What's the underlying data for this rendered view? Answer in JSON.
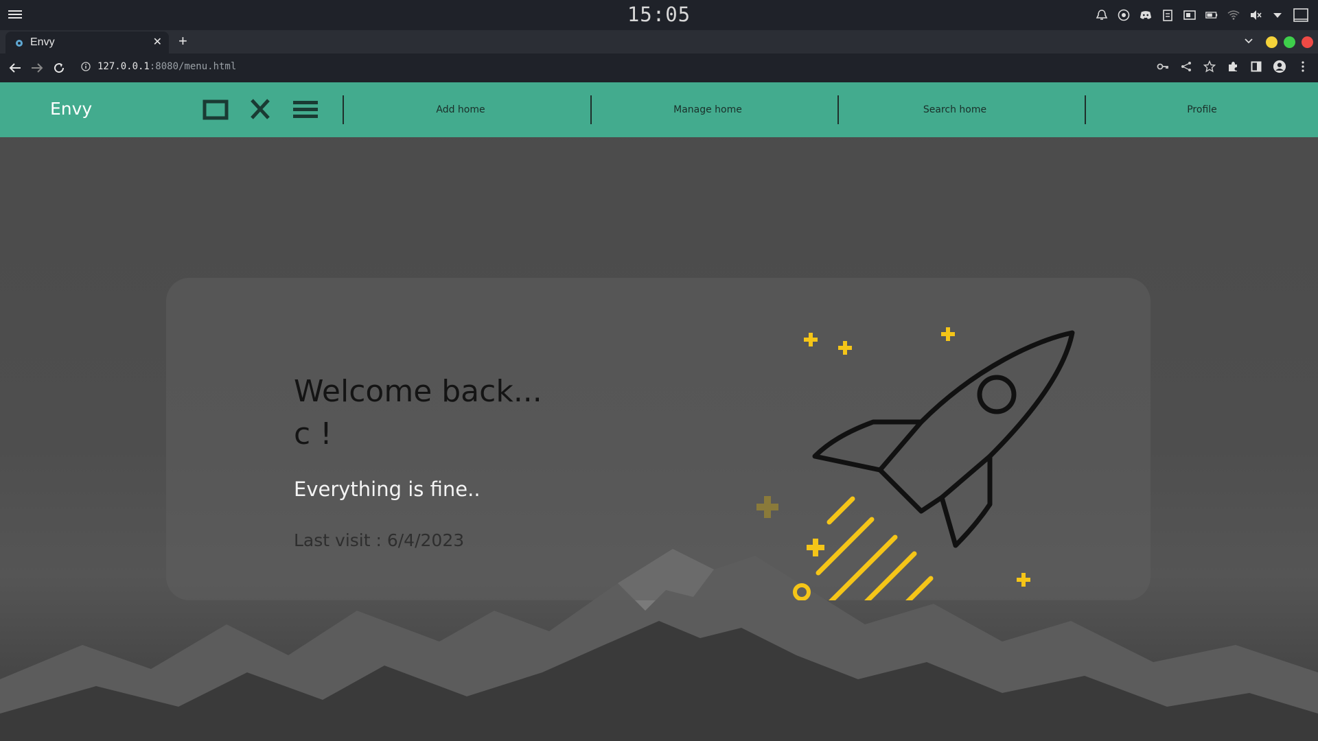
{
  "system": {
    "clock": "15:05",
    "tray_icons": [
      "bell-icon",
      "chrome-icon",
      "discord-icon",
      "clipboard-icon",
      "screenshot-icon",
      "battery-icon",
      "wifi-icon",
      "volume-muted-icon",
      "dropdown-icon",
      "window-icon"
    ]
  },
  "browser": {
    "tab_title": "Envy",
    "url_host": "127.0.0.1",
    "url_rest": ":8080/menu.html",
    "window_colors": {
      "minimize": "#f5d33a",
      "maximize": "#3ecf4b",
      "close": "#ef4a45"
    }
  },
  "navbar": {
    "brand": "Envy",
    "bg_color": "#43ab8e",
    "links": [
      {
        "label": "Add home"
      },
      {
        "label": "Manage home"
      },
      {
        "label": "Search home"
      },
      {
        "label": "Profile"
      }
    ]
  },
  "card": {
    "welcome_line1": "Welcome back...",
    "welcome_line2": "c !",
    "status": "Everything is fine..",
    "last_visit": "Last visit : 6/4/2023",
    "accent_color": "#f5c518"
  }
}
